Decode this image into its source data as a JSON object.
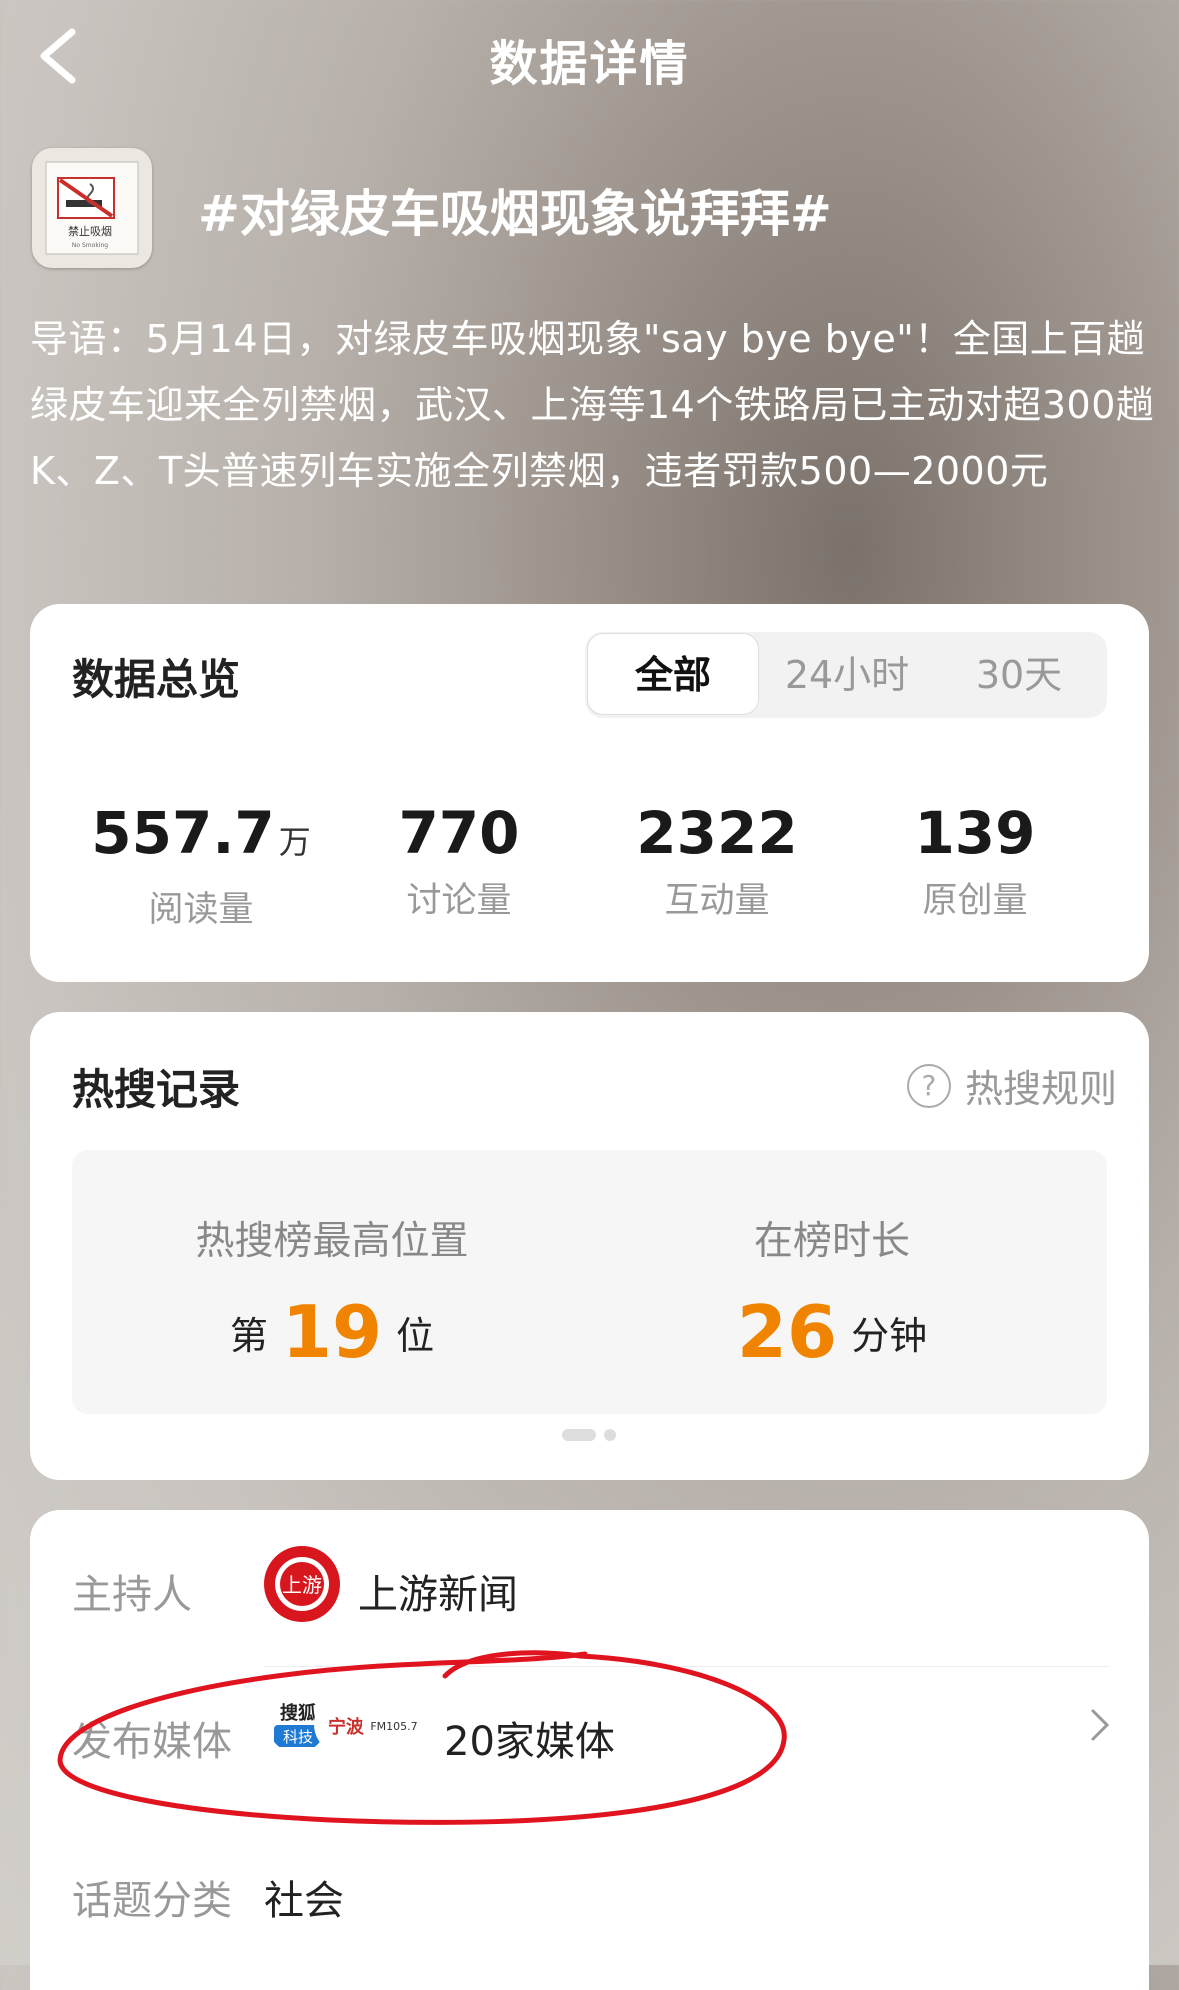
{
  "header": {
    "title": "数据详情",
    "back_icon": "chevron-left-icon"
  },
  "topic": {
    "title": "#对绿皮车吸烟现象说拜拜#",
    "icon": "no-smoking-icon",
    "icon_text": "禁止吸烟",
    "icon_subtext": "No Smoking",
    "intro": "导语：5月14日，对绿皮车吸烟现象\"say bye bye\"！全国上百趟绿皮车迎来全列禁烟，武汉、上海等14个铁路局已主动对超300趟K、Z、T头普速列车实施全列禁烟，违者罚款500—2000元"
  },
  "overview": {
    "title": "数据总览",
    "tabs": [
      "全部",
      "24小时",
      "30天"
    ],
    "active_tab": "全部",
    "stats": [
      {
        "value": "557.7",
        "unit": "万",
        "label": "阅读量"
      },
      {
        "value": "770",
        "unit": "",
        "label": "讨论量"
      },
      {
        "value": "2322",
        "unit": "",
        "label": "互动量"
      },
      {
        "value": "139",
        "unit": "",
        "label": "原创量"
      }
    ]
  },
  "hot_search": {
    "title": "热搜记录",
    "rules_label": "热搜规则",
    "highest_label": "热搜榜最高位置",
    "highest_prefix": "第",
    "highest_value": "19",
    "highest_suffix": "位",
    "duration_label": "在榜时长",
    "duration_value": "26",
    "duration_unit": "分钟"
  },
  "info": {
    "host_label": "主持人",
    "host_name": "上游新闻",
    "host_logo_text": "上游",
    "media_label": "发布媒体",
    "media_count": "20家媒体",
    "media_logos": [
      "搜狐",
      "科技",
      "宁波",
      "FM105.7"
    ],
    "category_label": "话题分类",
    "category_value": "社会"
  },
  "colors": {
    "accent": "#f08300",
    "host_logo": "#d7161e",
    "annotation": "#e0141e"
  }
}
